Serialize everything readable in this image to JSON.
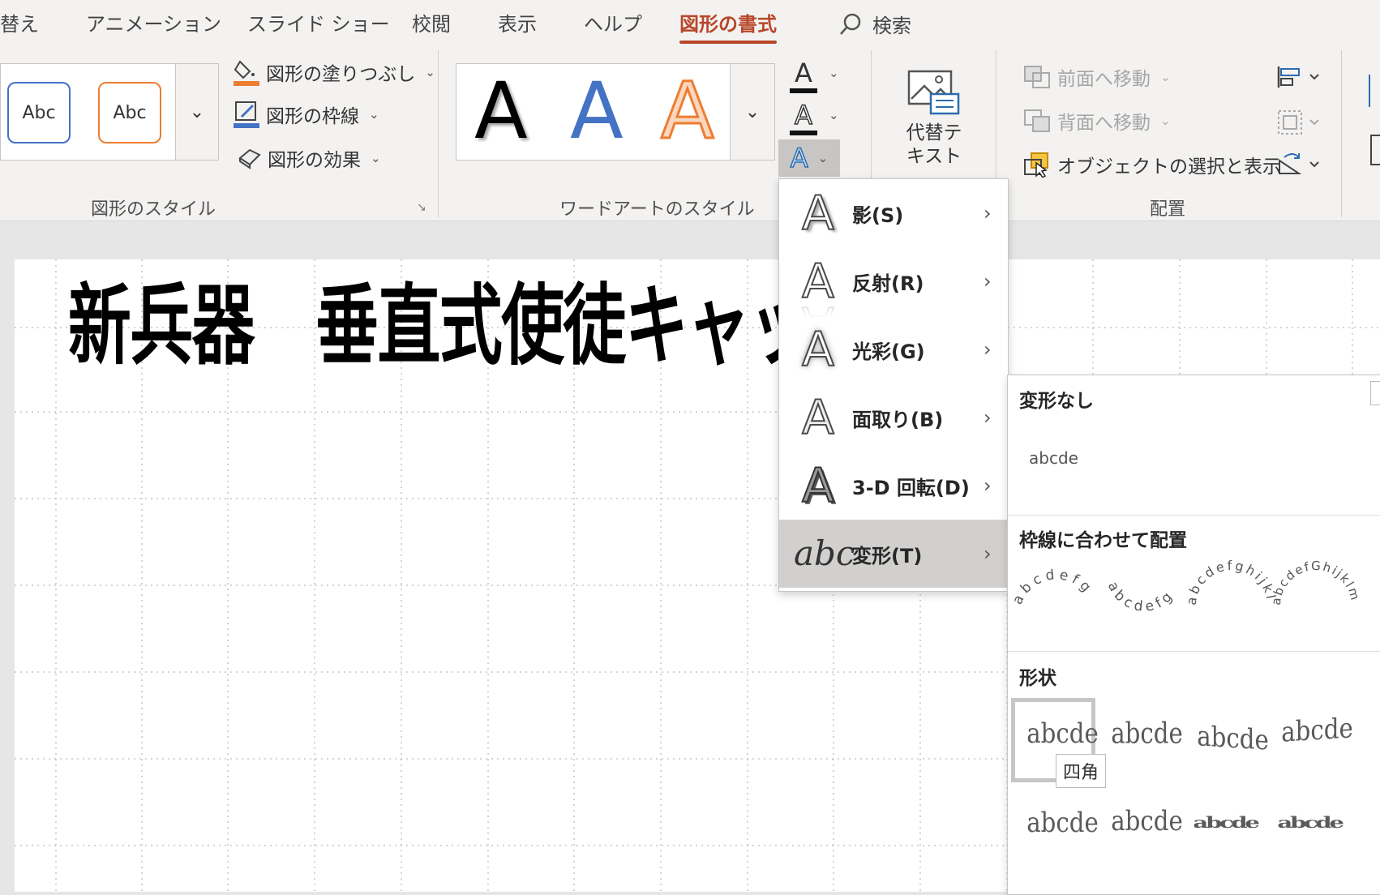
{
  "tabs": [
    {
      "label": "替え",
      "active": false
    },
    {
      "label": "アニメーション",
      "active": false
    },
    {
      "label": "スライド ショー",
      "active": false
    },
    {
      "label": "校閲",
      "active": false
    },
    {
      "label": "表示",
      "active": false
    },
    {
      "label": "ヘルプ",
      "active": false
    },
    {
      "label": "図形の書式",
      "active": true
    }
  ],
  "search": {
    "label": "検索"
  },
  "shape_styles": {
    "group_label": "図形のスタイル",
    "swatches": [
      "Abc",
      "Abc"
    ],
    "fill_label": "図形の塗りつぶし",
    "outline_label": "図形の枠線",
    "effects_label": "図形の効果"
  },
  "wordart": {
    "group_label": "ワードアートのスタイル",
    "samples": [
      "A",
      "A",
      "A"
    ],
    "text_fill": "A",
    "text_outline": "A",
    "text_effects": "A"
  },
  "accessibility": {
    "alt_text_label": "代替テ\nキスト"
  },
  "arrange": {
    "group_label": "配置",
    "bring_forward": "前面へ移動",
    "send_backward": "背面へ移動",
    "selection_pane": "オブジェクトの選択と表示"
  },
  "slide": {
    "title": "新兵器　垂直式使徒キャッチャ"
  },
  "effects_menu": {
    "items": [
      {
        "glyph": "A",
        "label": "影(S)",
        "selected": false
      },
      {
        "glyph": "A",
        "label": "反射(R)",
        "selected": false
      },
      {
        "glyph": "A",
        "label": "光彩(G)",
        "selected": false
      },
      {
        "glyph": "A",
        "label": "面取り(B)",
        "selected": false
      },
      {
        "glyph": "A",
        "label": "3-D 回転(D)",
        "selected": false
      },
      {
        "glyph": "abc",
        "label": "変形(T)",
        "selected": true
      }
    ],
    "arrow": "›"
  },
  "transform_gallery": {
    "no_transform_label": "変形なし",
    "no_transform_sample": "abcde",
    "follow_path_label": "枠線に合わせて配置",
    "follow_path_samples": [
      "abcdefg",
      "abcdefg",
      "abcdefghijklm",
      "abcdefGhijklmnop"
    ],
    "warp_label": "形状",
    "warp_samples": [
      "abcde",
      "abcde",
      "abcde",
      "abcde",
      "abcde",
      "abcde",
      "abcde",
      "abcde"
    ],
    "tooltip": "四角"
  },
  "colors": {
    "accent": "#b7472a",
    "blue": "#4472c4",
    "orange": "#ed7d31"
  }
}
